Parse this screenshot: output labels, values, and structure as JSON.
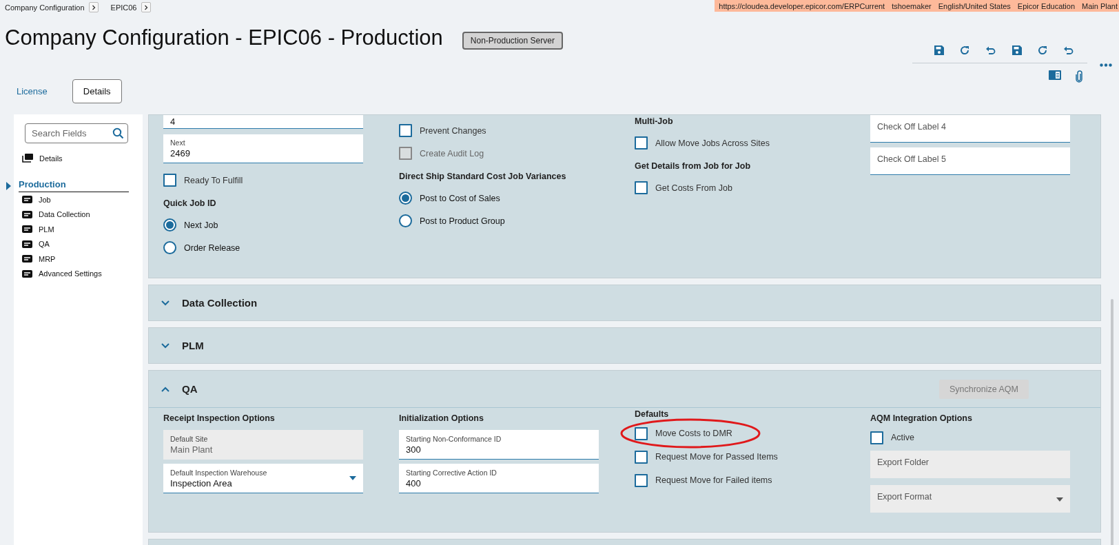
{
  "breadcrumbs": [
    {
      "label": "Company Configuration"
    },
    {
      "label": "EPIC06"
    }
  ],
  "session_bar": [
    "https://cloudea.developer.epicor.com/ERPCurrent",
    "tshoemaker",
    "English/United States",
    "Epicor Education",
    "Main Plant"
  ],
  "title": "Company Configuration - EPIC06 - Production",
  "server_badge": "Non-Production Server",
  "toolbar": {
    "buttons": [
      {
        "kind": "save"
      },
      {
        "kind": "refresh"
      },
      {
        "kind": "undo"
      },
      {
        "kind": "save"
      },
      {
        "kind": "refresh"
      },
      {
        "kind": "undo"
      }
    ],
    "secondary": [
      {
        "kind": "panel"
      },
      {
        "kind": "attach"
      }
    ]
  },
  "tabs": [
    {
      "label": "License",
      "selected": false
    },
    {
      "label": "Details",
      "selected": true
    }
  ],
  "sidebar": {
    "search_placeholder": "Search Fields",
    "top_item": "Details",
    "group": {
      "label": "Production",
      "expanded": true,
      "items": [
        "Job",
        "Data Collection",
        "PLM",
        "QA",
        "MRP",
        "Advanced Settings"
      ]
    }
  },
  "production_section": {
    "columns": [
      [
        {
          "kind": "field",
          "value": "4",
          "readonly": false
        },
        {
          "kind": "field",
          "label": "Next",
          "value": "2469",
          "readonly": false
        },
        {
          "kind": "checkbox",
          "label": "Ready To Fulfill",
          "checked": false,
          "disabled": false
        },
        {
          "kind": "heading",
          "label": "Quick Job ID"
        },
        {
          "kind": "radio",
          "label": "Next Job",
          "selected": true
        },
        {
          "kind": "radio",
          "label": "Order Release",
          "selected": false
        }
      ],
      [
        {
          "kind": "checkbox",
          "label": "Prevent Changes",
          "checked": false,
          "disabled": false
        },
        {
          "kind": "checkbox",
          "label": "Create Audit Log",
          "checked": false,
          "disabled": true
        },
        {
          "kind": "heading",
          "label": "Direct Ship Standard Cost Job Variances"
        },
        {
          "kind": "radio",
          "label": "Post to Cost of Sales",
          "selected": true
        },
        {
          "kind": "radio",
          "label": "Post to Product Group",
          "selected": false
        }
      ],
      [
        {
          "kind": "heading",
          "label": "Multi-Job"
        },
        {
          "kind": "checkbox",
          "label": "Allow Move Jobs Across Sites",
          "checked": false,
          "disabled": false
        },
        {
          "kind": "heading",
          "label": "Get Details from Job for Job"
        },
        {
          "kind": "checkbox",
          "label": "Get Costs From Job",
          "checked": false,
          "disabled": false
        }
      ],
      [
        {
          "kind": "field",
          "placeholder": "Check Off Label 4",
          "readonly": false
        },
        {
          "kind": "field",
          "placeholder": "Check Off Label 5",
          "readonly": false
        }
      ]
    ]
  },
  "panels": [
    {
      "title": "Data Collection",
      "expanded": false
    },
    {
      "title": "PLM",
      "expanded": false
    },
    {
      "title": "QA",
      "expanded": true,
      "action": "Synchronize AQM",
      "columns": [
        [
          {
            "kind": "heading",
            "label": "Receipt Inspection Options"
          },
          {
            "kind": "field",
            "label": "Default Site",
            "value": "Main Plant",
            "readonly": true
          },
          {
            "kind": "dropdown",
            "label": "Default Inspection Warehouse",
            "value": "Inspection Area",
            "readonly": false
          }
        ],
        [
          {
            "kind": "heading",
            "label": "Initialization Options"
          },
          {
            "kind": "field",
            "label": "Starting Non-Conformance ID",
            "value": "300",
            "readonly": false
          },
          {
            "kind": "field",
            "label": "Starting Corrective Action ID",
            "value": "400",
            "readonly": false
          }
        ],
        [
          {
            "kind": "heading",
            "label": "Defaults"
          },
          {
            "kind": "checkbox",
            "label": "Move Costs to DMR",
            "checked": false,
            "disabled": false,
            "circled": true
          },
          {
            "kind": "checkbox",
            "label": "Request Move for Passed Items",
            "checked": false,
            "disabled": false,
            "circled": false
          },
          {
            "kind": "checkbox",
            "label": "Request Move for Failed items",
            "checked": false,
            "disabled": false,
            "circled": false
          }
        ],
        [
          {
            "kind": "heading",
            "label": "AQM Integration Options"
          },
          {
            "kind": "checkbox",
            "label": "Active",
            "checked": false,
            "disabled": false,
            "circled": false
          },
          {
            "kind": "field",
            "placeholder": "Export Folder",
            "readonly": true
          },
          {
            "kind": "dropdown",
            "placeholder": "Export Format",
            "readonly": true
          }
        ]
      ]
    }
  ]
}
